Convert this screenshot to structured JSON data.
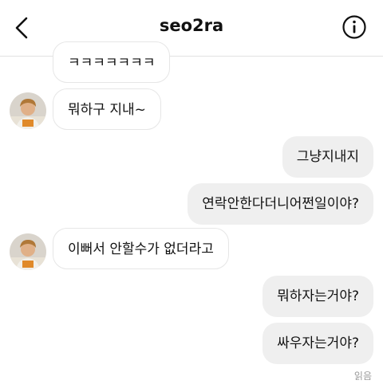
{
  "header": {
    "title": "seo2ra",
    "back_icon": "chevron-left-icon",
    "info_icon": "info-circle-icon"
  },
  "messages": [
    {
      "side": "in",
      "text": "ㅋㅋㅋㅋㅋㅋㅋ",
      "avatar": false
    },
    {
      "side": "in",
      "text": "뭐하구 지내~",
      "avatar": true
    },
    {
      "side": "out",
      "text": "그냥지내지"
    },
    {
      "side": "out",
      "text": "연락안한다더니어쩐일이야?"
    },
    {
      "side": "in",
      "text": "이뻐서 안할수가 없더라고",
      "avatar": true
    },
    {
      "side": "out",
      "text": "뭐하자는거야?"
    },
    {
      "side": "out",
      "text": "싸우자는거야?"
    }
  ],
  "status": {
    "read_label": "읽음"
  },
  "colors": {
    "outgoing_bubble": "#efefef",
    "incoming_border": "#e6e6e6",
    "read_text": "#9a9a9a"
  }
}
